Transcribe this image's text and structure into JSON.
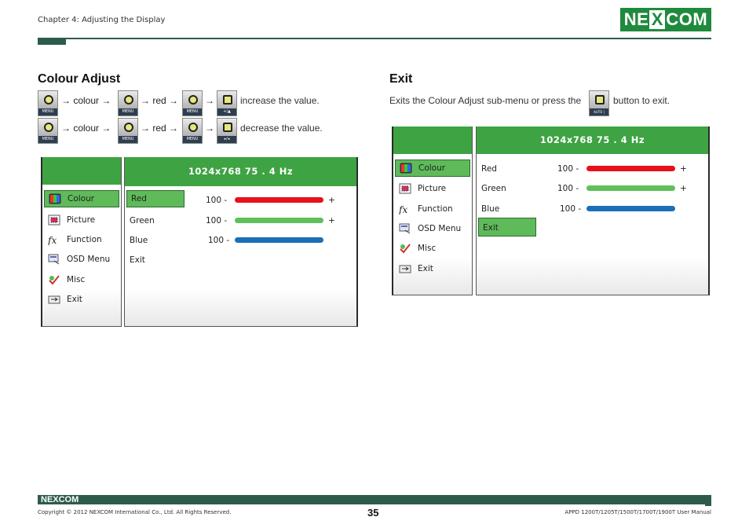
{
  "header": {
    "chapter": "Chapter 4: Adjusting the Display",
    "logo": "NEXCOM"
  },
  "colour_adjust": {
    "title": "Colour Adjust",
    "row1": {
      "a1": "→ colour →",
      "a2": "→ red →",
      "a3": "→",
      "tail": "increase the value."
    },
    "row2": {
      "a1": "→ colour →",
      "a2": "→ red →",
      "a3": "→",
      "tail": "decrease the value."
    },
    "btn_menu": "MENU"
  },
  "exit": {
    "title": "Exit",
    "text_before": "Exits the Colour Adjust sub-menu or press the",
    "text_after": "button to exit.",
    "btn_label": "AUTO | EXIT"
  },
  "osd1": {
    "resolution": "1024x768  75  . 4 Hz",
    "menu": [
      {
        "label": "Colour",
        "icon": "colour-icon",
        "selected": true
      },
      {
        "label": "Picture",
        "icon": "picture-icon",
        "selected": false
      },
      {
        "label": "Function",
        "icon": "function-icon",
        "selected": false
      },
      {
        "label": "OSD Menu",
        "icon": "osd-menu-icon",
        "selected": false
      },
      {
        "label": "Misc",
        "icon": "misc-icon",
        "selected": false
      },
      {
        "label": "Exit",
        "icon": "exit-icon",
        "selected": false
      }
    ],
    "sub": [
      {
        "label": "Red",
        "value": "100 -",
        "plus": "+",
        "color": "#e8101a",
        "level": 1.0,
        "selected": true
      },
      {
        "label": "Green",
        "value": "100 -",
        "plus": "+",
        "color": "#5fbf5a",
        "level": 1.0,
        "selected": false
      },
      {
        "label": "Blue",
        "value": "100 -",
        "plus": "",
        "color": "#1a6fb8",
        "level": 1.0,
        "selected": false
      },
      {
        "label": "Exit",
        "selected": false
      }
    ]
  },
  "osd2": {
    "resolution": "1024x768  75  . 4 Hz",
    "menu": [
      {
        "label": "Colour",
        "selected": true
      },
      {
        "label": "Picture",
        "selected": false
      },
      {
        "label": "Function",
        "selected": false
      },
      {
        "label": "OSD Menu",
        "selected": false
      },
      {
        "label": "Misc",
        "selected": false
      },
      {
        "label": "Exit",
        "selected": false
      }
    ],
    "sub": [
      {
        "label": "Red",
        "value": "100 -",
        "plus": "+",
        "color": "#e8101a",
        "level": 1.0
      },
      {
        "label": "Green",
        "value": "100 -",
        "plus": "+",
        "color": "#5fbf5a",
        "level": 1.0
      },
      {
        "label": "Blue",
        "value": "100 -",
        "plus": "",
        "color": "#1a6fb8",
        "level": 1.0
      },
      {
        "label": "Exit",
        "selected": true
      }
    ]
  },
  "footer": {
    "logo": "NEXCOM",
    "copyright": "Copyright © 2012 NEXCOM International Co., Ltd. All Rights Reserved.",
    "page": "35",
    "manual": "APPD 1200T/1205T/1500T/1700T/1900T User Manual"
  }
}
